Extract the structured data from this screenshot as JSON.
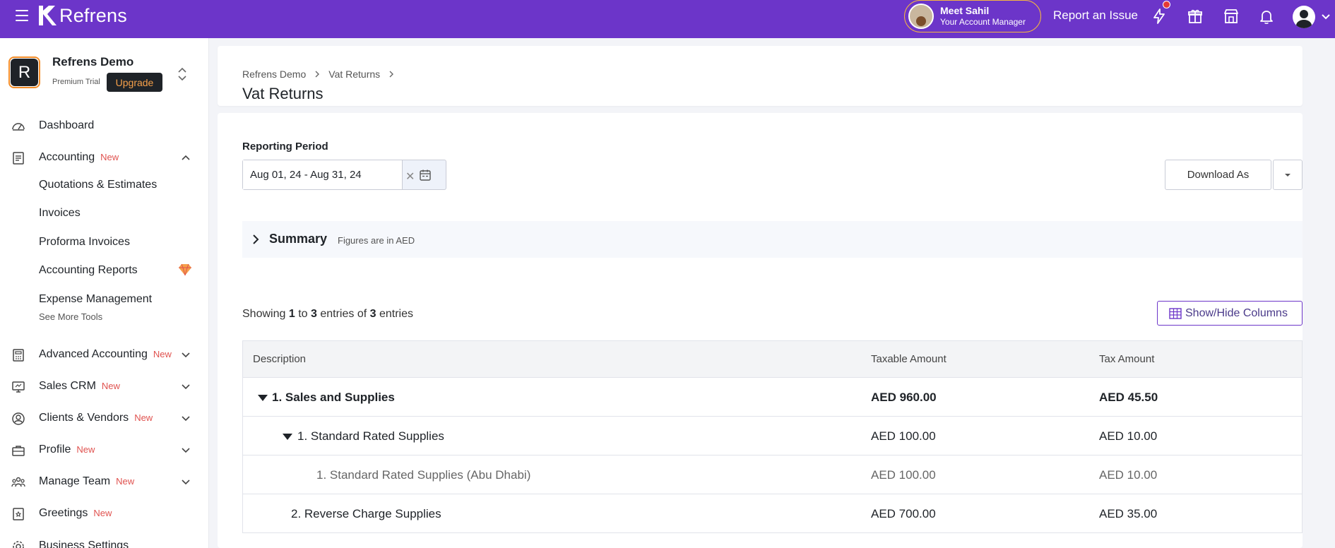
{
  "topbar": {
    "brand": "Refrens",
    "manager_name": "Meet Sahil",
    "manager_role": "Your Account Manager",
    "report_issue": "Report an Issue"
  },
  "sidebar": {
    "org_initial": "R",
    "org_name": "Refrens Demo",
    "org_plan": "Premium Trial",
    "upgrade": "Upgrade",
    "items": [
      {
        "label": "Dashboard"
      },
      {
        "label": "Accounting",
        "badge": "New"
      },
      {
        "label": "Advanced Accounting",
        "badge": "New"
      },
      {
        "label": "Sales CRM",
        "badge": "New"
      },
      {
        "label": "Clients & Vendors",
        "badge": "New"
      },
      {
        "label": "Profile",
        "badge": "New"
      },
      {
        "label": "Manage Team",
        "badge": "New"
      },
      {
        "label": "Greetings",
        "badge": "New"
      },
      {
        "label": "Business Settings"
      }
    ],
    "accounting_sub": [
      {
        "label": "Quotations & Estimates"
      },
      {
        "label": "Invoices"
      },
      {
        "label": "Proforma Invoices"
      },
      {
        "label": "Accounting Reports"
      },
      {
        "label": "Expense Management"
      }
    ],
    "see_more": "See More Tools"
  },
  "header": {
    "breadcrumb": [
      "Refrens Demo",
      "Vat Returns"
    ],
    "title": "Vat Returns"
  },
  "filters": {
    "reporting_period_label": "Reporting Period",
    "reporting_period_value": "Aug 01, 24 - Aug 31, 24",
    "download_label": "Download As"
  },
  "summary": {
    "title": "Summary",
    "note": "Figures are in AED"
  },
  "entries": {
    "prefix": "Showing",
    "from": "1",
    "to_word": "to",
    "to": "3",
    "entries_of": "entries of",
    "total": "3",
    "suffix": "entries",
    "columns_button": "Show/Hide Columns"
  },
  "table": {
    "headers": [
      "Description",
      "Taxable Amount",
      "Tax Amount"
    ],
    "rows": [
      {
        "description": "1. Sales and Supplies",
        "taxable": "AED 960.00",
        "tax": "AED 45.50"
      },
      {
        "description": "1. Standard Rated Supplies",
        "taxable": "AED 100.00",
        "tax": "AED 10.00"
      },
      {
        "description": "1. Standard Rated Supplies (Abu Dhabi)",
        "taxable": "AED 100.00",
        "tax": "AED 10.00"
      },
      {
        "description": "2. Reverse Charge Supplies",
        "taxable": "AED 700.00",
        "tax": "AED 35.00"
      }
    ]
  },
  "colors": {
    "brand_purple": "#6c35c9",
    "badge_red": "#e0524f",
    "upgrade_orange": "#f6a04a"
  }
}
